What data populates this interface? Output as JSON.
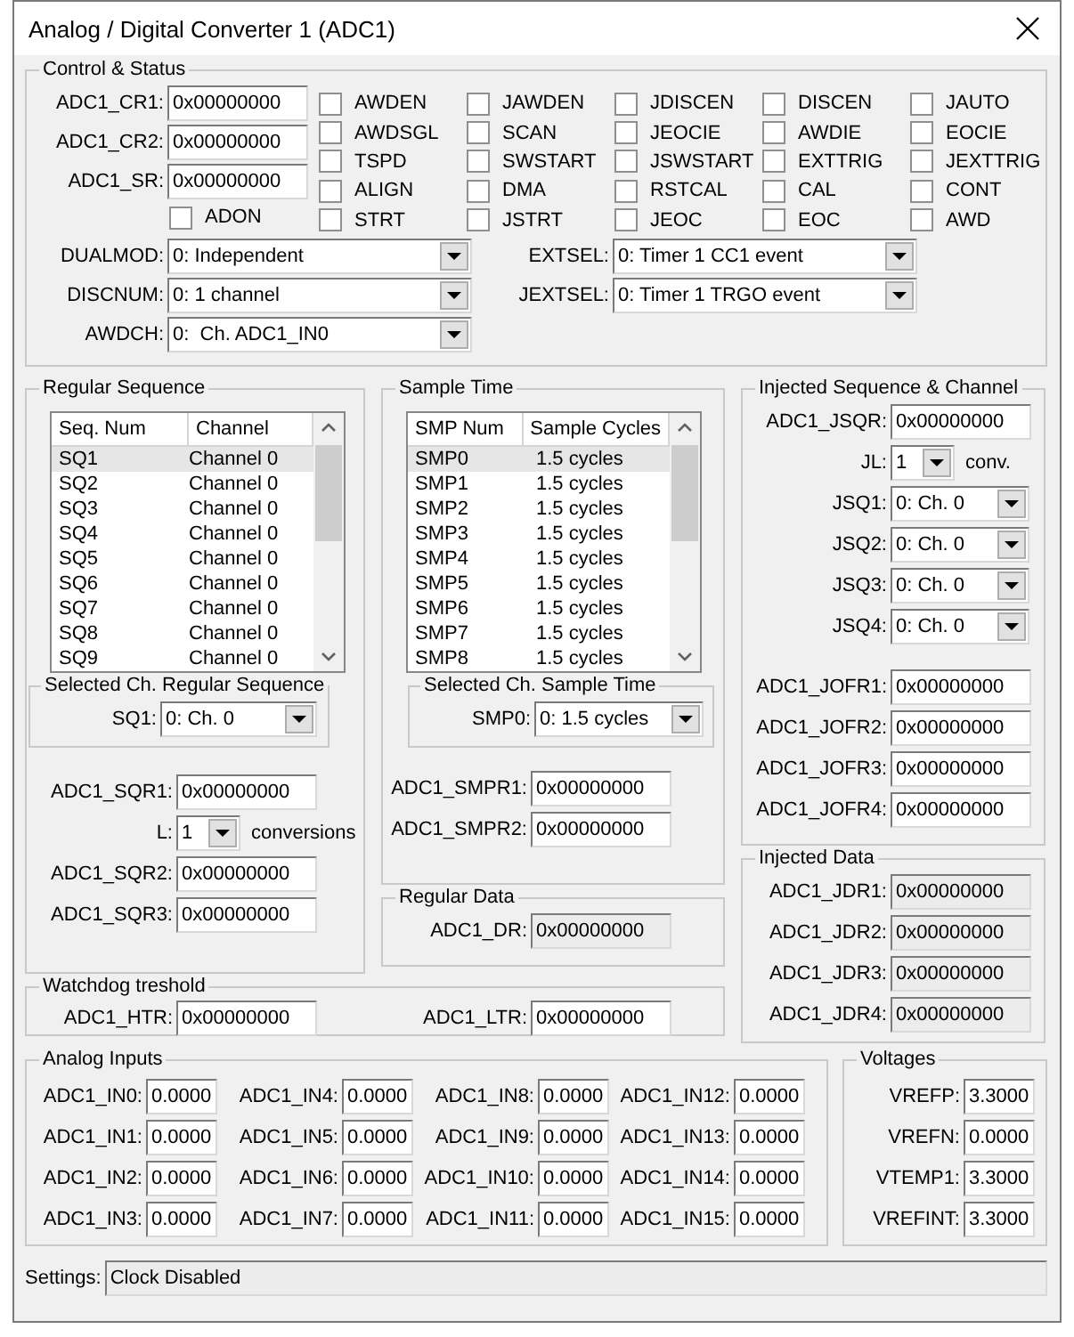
{
  "window": {
    "title": "Analog / Digital Converter 1 (ADC1)"
  },
  "control_status": {
    "title": "Control & Status",
    "registers": [
      {
        "label": "ADC1_CR1:",
        "value": "0x00000000",
        "read_only": false
      },
      {
        "label": "ADC1_CR2:",
        "value": "0x00000000",
        "read_only": false
      },
      {
        "label": "ADC1_SR:",
        "value": "0x00000000",
        "read_only": false
      }
    ],
    "adon": {
      "label": "ADON",
      "checked": false
    },
    "flags": [
      {
        "label": "AWDEN",
        "checked": false
      },
      {
        "label": "JAWDEN",
        "checked": false
      },
      {
        "label": "JDISCEN",
        "checked": false
      },
      {
        "label": "DISCEN",
        "checked": false
      },
      {
        "label": "JAUTO",
        "checked": false
      },
      {
        "label": "AWDSGL",
        "checked": false
      },
      {
        "label": "SCAN",
        "checked": false
      },
      {
        "label": "JEOCIE",
        "checked": false
      },
      {
        "label": "AWDIE",
        "checked": false
      },
      {
        "label": "EOCIE",
        "checked": false
      },
      {
        "label": "TSPD",
        "checked": false
      },
      {
        "label": "SWSTART",
        "checked": false
      },
      {
        "label": "JSWSTART",
        "checked": false
      },
      {
        "label": "EXTTRIG",
        "checked": false
      },
      {
        "label": "JEXTTRIG",
        "checked": false
      },
      {
        "label": "ALIGN",
        "checked": false
      },
      {
        "label": "DMA",
        "checked": false
      },
      {
        "label": "RSTCAL",
        "checked": false
      },
      {
        "label": "CAL",
        "checked": false
      },
      {
        "label": "CONT",
        "checked": false
      },
      {
        "label": "STRT",
        "checked": false
      },
      {
        "label": "JSTRT",
        "checked": false
      },
      {
        "label": "JEOC",
        "checked": false
      },
      {
        "label": "EOC",
        "checked": false
      },
      {
        "label": "AWD",
        "checked": false
      }
    ],
    "selects_left": [
      {
        "label": "DUALMOD:",
        "value": "0: Independent"
      },
      {
        "label": "DISCNUM:",
        "value": "0: 1 channel"
      },
      {
        "label": "AWDCH:",
        "value": "0:  Ch. ADC1_IN0"
      }
    ],
    "selects_right": [
      {
        "label": "EXTSEL:",
        "value": "0: Timer 1 CC1 event"
      },
      {
        "label": "JEXTSEL:",
        "value": "0: Timer 1 TRGO event"
      }
    ]
  },
  "regular_sequence": {
    "title": "Regular Sequence",
    "columns": [
      "Seq. Num",
      "Channel"
    ],
    "rows": [
      {
        "cells": [
          "SQ1",
          "Channel 0"
        ],
        "selected": true
      },
      {
        "cells": [
          "SQ2",
          "Channel 0"
        ],
        "selected": false
      },
      {
        "cells": [
          "SQ3",
          "Channel 0"
        ],
        "selected": false
      },
      {
        "cells": [
          "SQ4",
          "Channel 0"
        ],
        "selected": false
      },
      {
        "cells": [
          "SQ5",
          "Channel 0"
        ],
        "selected": false
      },
      {
        "cells": [
          "SQ6",
          "Channel 0"
        ],
        "selected": false
      },
      {
        "cells": [
          "SQ7",
          "Channel 0"
        ],
        "selected": false
      },
      {
        "cells": [
          "SQ8",
          "Channel 0"
        ],
        "selected": false
      },
      {
        "cells": [
          "SQ9",
          "Channel 0"
        ],
        "selected": false
      }
    ],
    "selected_group": {
      "title": "Selected Ch. Regular Sequence",
      "select": {
        "label": "SQ1:",
        "value": "0: Ch. 0"
      }
    },
    "fields": [
      {
        "kind": "field",
        "label": "ADC1_SQR1:",
        "value": "0x00000000",
        "read_only": false
      },
      {
        "kind": "length",
        "label": "L:",
        "value": "1",
        "suffix": "conversions"
      },
      {
        "kind": "field",
        "label": "ADC1_SQR2:",
        "value": "0x00000000",
        "read_only": false
      },
      {
        "kind": "field",
        "label": "ADC1_SQR3:",
        "value": "0x00000000",
        "read_only": false
      }
    ]
  },
  "sample_time": {
    "title": "Sample Time",
    "columns": [
      "SMP Num",
      "Sample Cycles"
    ],
    "rows": [
      {
        "cells": [
          "SMP0",
          "1.5 cycles"
        ],
        "selected": true
      },
      {
        "cells": [
          "SMP1",
          "1.5 cycles"
        ],
        "selected": false
      },
      {
        "cells": [
          "SMP2",
          "1.5 cycles"
        ],
        "selected": false
      },
      {
        "cells": [
          "SMP3",
          "1.5 cycles"
        ],
        "selected": false
      },
      {
        "cells": [
          "SMP4",
          "1.5 cycles"
        ],
        "selected": false
      },
      {
        "cells": [
          "SMP5",
          "1.5 cycles"
        ],
        "selected": false
      },
      {
        "cells": [
          "SMP6",
          "1.5 cycles"
        ],
        "selected": false
      },
      {
        "cells": [
          "SMP7",
          "1.5 cycles"
        ],
        "selected": false
      },
      {
        "cells": [
          "SMP8",
          "1.5 cycles"
        ],
        "selected": false
      }
    ],
    "selected_group": {
      "title": "Selected Ch. Sample Time",
      "select": {
        "label": "SMP0:",
        "value": "0: 1.5 cycles"
      }
    },
    "fields": [
      {
        "label": "ADC1_SMPR1:",
        "value": "0x00000000",
        "read_only": false
      },
      {
        "label": "ADC1_SMPR2:",
        "value": "0x00000000",
        "read_only": false
      }
    ]
  },
  "regular_data": {
    "title": "Regular Data",
    "fields": [
      {
        "label": "ADC1_DR:",
        "value": "0x00000000",
        "read_only": true
      }
    ]
  },
  "injected_sequence": {
    "title": "Injected Sequence & Channel",
    "controls": [
      {
        "kind": "field",
        "label": "ADC1_JSQR:",
        "value": "0x00000000",
        "read_only": false
      },
      {
        "kind": "length",
        "label": "JL:",
        "value": "1",
        "suffix": "conv."
      },
      {
        "kind": "select",
        "label": "JSQ1:",
        "value": "0: Ch. 0"
      },
      {
        "kind": "select",
        "label": "JSQ2:",
        "value": "0: Ch. 0"
      },
      {
        "kind": "select",
        "label": "JSQ3:",
        "value": "0: Ch. 0"
      },
      {
        "kind": "select",
        "label": "JSQ4:",
        "value": "0: Ch. 0"
      }
    ],
    "offsets": [
      {
        "label": "ADC1_JOFR1:",
        "value": "0x00000000",
        "read_only": false
      },
      {
        "label": "ADC1_JOFR2:",
        "value": "0x00000000",
        "read_only": false
      },
      {
        "label": "ADC1_JOFR3:",
        "value": "0x00000000",
        "read_only": false
      },
      {
        "label": "ADC1_JOFR4:",
        "value": "0x00000000",
        "read_only": false
      }
    ]
  },
  "injected_data": {
    "title": "Injected Data",
    "fields": [
      {
        "label": "ADC1_JDR1:",
        "value": "0x00000000",
        "read_only": true
      },
      {
        "label": "ADC1_JDR2:",
        "value": "0x00000000",
        "read_only": true
      },
      {
        "label": "ADC1_JDR3:",
        "value": "0x00000000",
        "read_only": true
      },
      {
        "label": "ADC1_JDR4:",
        "value": "0x00000000",
        "read_only": true
      }
    ]
  },
  "watchdog": {
    "title": "Watchdog treshold",
    "fields": [
      {
        "label": "ADC1_HTR:",
        "value": "0x00000000",
        "read_only": false
      },
      {
        "label": "ADC1_LTR:",
        "value": "0x00000000",
        "read_only": false
      }
    ]
  },
  "analog_inputs": {
    "title": "Analog Inputs",
    "fields": [
      {
        "label": "ADC1_IN0:",
        "value": "0.0000",
        "read_only": false
      },
      {
        "label": "ADC1_IN4:",
        "value": "0.0000",
        "read_only": false
      },
      {
        "label": "ADC1_IN8:",
        "value": "0.0000",
        "read_only": false
      },
      {
        "label": "ADC1_IN12:",
        "value": "0.0000",
        "read_only": false
      },
      {
        "label": "ADC1_IN1:",
        "value": "0.0000",
        "read_only": false
      },
      {
        "label": "ADC1_IN5:",
        "value": "0.0000",
        "read_only": false
      },
      {
        "label": "ADC1_IN9:",
        "value": "0.0000",
        "read_only": false
      },
      {
        "label": "ADC1_IN13:",
        "value": "0.0000",
        "read_only": false
      },
      {
        "label": "ADC1_IN2:",
        "value": "0.0000",
        "read_only": false
      },
      {
        "label": "ADC1_IN6:",
        "value": "0.0000",
        "read_only": false
      },
      {
        "label": "ADC1_IN10:",
        "value": "0.0000",
        "read_only": false
      },
      {
        "label": "ADC1_IN14:",
        "value": "0.0000",
        "read_only": false
      },
      {
        "label": "ADC1_IN3:",
        "value": "0.0000",
        "read_only": false
      },
      {
        "label": "ADC1_IN7:",
        "value": "0.0000",
        "read_only": false
      },
      {
        "label": "ADC1_IN11:",
        "value": "0.0000",
        "read_only": false
      },
      {
        "label": "ADC1_IN15:",
        "value": "0.0000",
        "read_only": false
      }
    ]
  },
  "voltages": {
    "title": "Voltages",
    "fields": [
      {
        "label": "VREFP:",
        "value": "3.3000",
        "read_only": false
      },
      {
        "label": "VREFN:",
        "value": "0.0000",
        "read_only": false
      },
      {
        "label": "VTEMP1:",
        "value": "3.3000",
        "read_only": false
      },
      {
        "label": "VREFINT:",
        "value": "3.3000",
        "read_only": false
      }
    ]
  },
  "settings": {
    "label": "Settings:",
    "value": "Clock Disabled",
    "read_only": true
  }
}
